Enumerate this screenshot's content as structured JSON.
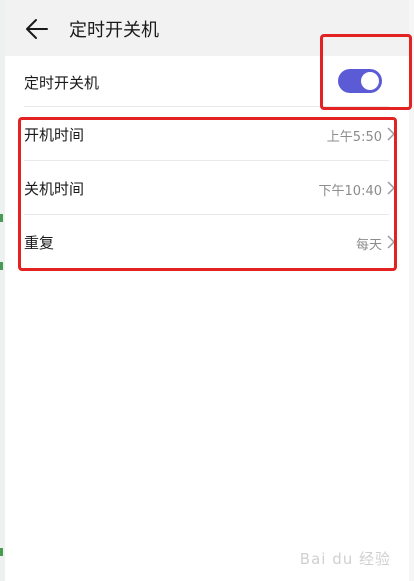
{
  "header": {
    "title": "定时开关机",
    "back_icon": "arrow-left-icon"
  },
  "main_toggle": {
    "label": "定时开关机",
    "enabled": true,
    "accent_color": "#5b5bd6"
  },
  "settings": [
    {
      "label": "开机时间",
      "value": "上午5:50",
      "icon": "chevron-right-icon"
    },
    {
      "label": "关机时间",
      "value": "下午10:40",
      "icon": "chevron-right-icon"
    },
    {
      "label": "重复",
      "value": "每天",
      "icon": "chevron-right-icon"
    }
  ],
  "highlight_color": "#e32222",
  "watermark": {
    "text": "Bai du 经验"
  }
}
